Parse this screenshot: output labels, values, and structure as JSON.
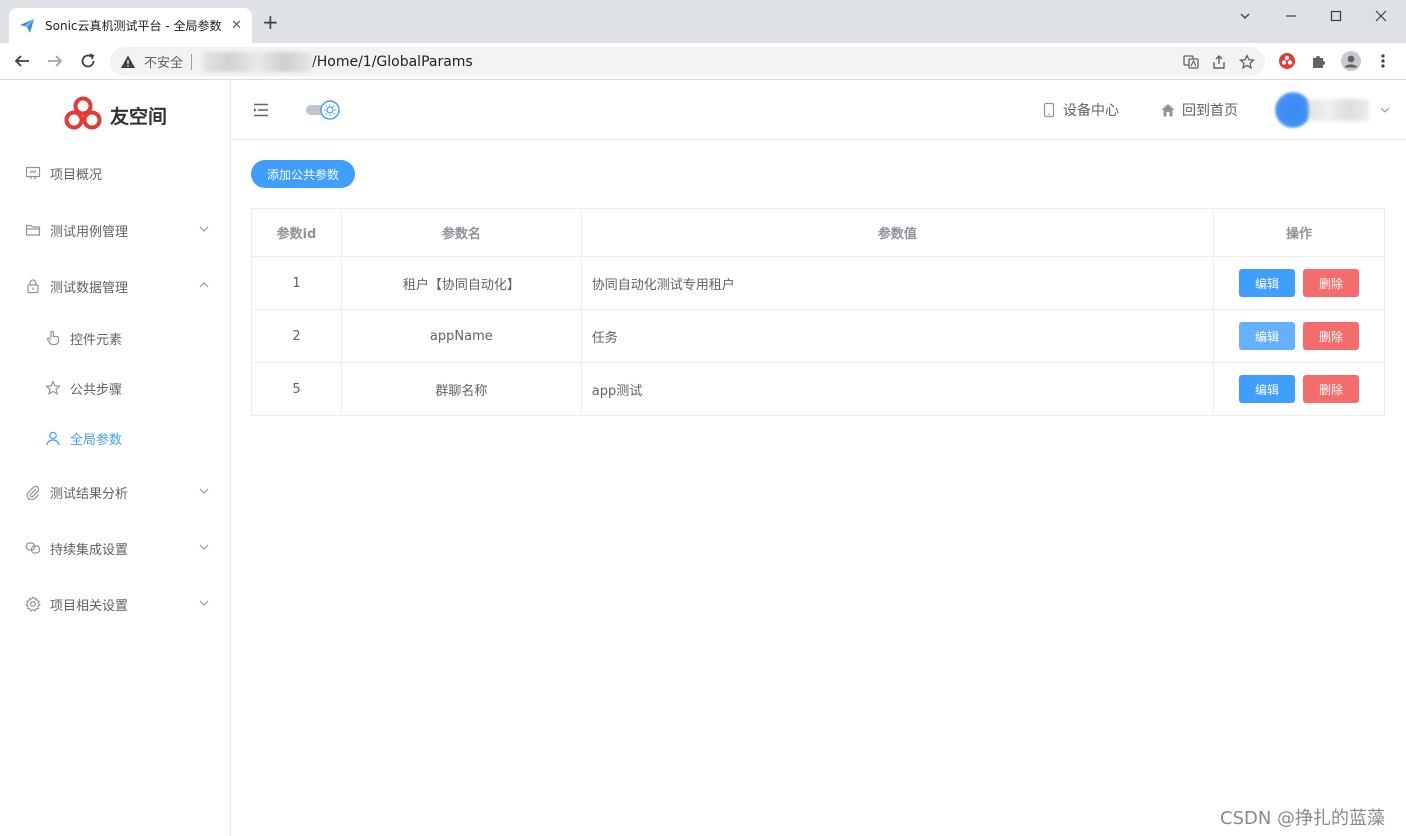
{
  "browser": {
    "tab_title": "Sonic云真机测试平台 - 全局参数",
    "security_label": "不安全",
    "url": "/Home/1/GlobalParams"
  },
  "app": {
    "logo_text": "友空间",
    "brand_color": "#409eff",
    "danger_color": "#f56c6c"
  },
  "sidebar": {
    "items": [
      {
        "label": "项目概况",
        "icon": "presentation-icon"
      },
      {
        "label": "测试用例管理",
        "icon": "folder-icon"
      },
      {
        "label": "测试数据管理",
        "icon": "lock-icon"
      },
      {
        "label": "控件元素",
        "icon": "pointer-hand-icon"
      },
      {
        "label": "公共步骤",
        "icon": "star-icon"
      },
      {
        "label": "全局参数",
        "icon": "user-icon"
      },
      {
        "label": "测试结果分析",
        "icon": "paperclip-icon"
      },
      {
        "label": "持续集成设置",
        "icon": "link-icon"
      },
      {
        "label": "项目相关设置",
        "icon": "gear-icon"
      }
    ]
  },
  "header": {
    "device_center": "设备中心",
    "back_home": "回到首页"
  },
  "main": {
    "add_button": "添加公共参数",
    "table": {
      "columns": [
        "参数id",
        "参数名",
        "参数值",
        "操作"
      ],
      "rows": [
        {
          "id": "1",
          "name": "租户【协同自动化】",
          "value": "协同自动化测试专用租户"
        },
        {
          "id": "2",
          "name": "appName",
          "value": "任务"
        },
        {
          "id": "5",
          "name": "群聊名称",
          "value": "app测试"
        }
      ],
      "edit_label": "编辑",
      "delete_label": "删除"
    }
  },
  "watermark": "CSDN @挣扎的蓝藻"
}
